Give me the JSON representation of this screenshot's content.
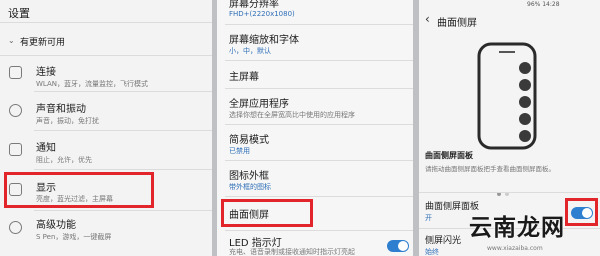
{
  "panel1": {
    "title": "设置",
    "update_label": "有更新可用",
    "items": [
      {
        "title": "连接",
        "sub": "WLAN，蓝牙，流量监控，飞行模式"
      },
      {
        "title": "声音和振动",
        "sub": "声音，振动，免打扰"
      },
      {
        "title": "通知",
        "sub": "阻止，允许，优先"
      },
      {
        "title": "显示",
        "sub": "亮度，蓝光过滤，主屏幕"
      },
      {
        "title": "高级功能",
        "sub": "S Pen，游戏，一键截屏"
      }
    ]
  },
  "panel2": {
    "items": [
      {
        "title": "屏幕分辨率",
        "sub": "FHD+(2220x1080)"
      },
      {
        "title": "屏幕缩放和字体",
        "sub": "小，中，默认"
      },
      {
        "title": "主屏幕",
        "sub": ""
      },
      {
        "title": "全屏应用程序",
        "sub": "选择你想在全屏宽高比中使用的应用程序"
      },
      {
        "title": "简易模式",
        "sub": "已禁用"
      },
      {
        "title": "图标外框",
        "sub": "带外框的图标"
      },
      {
        "title": "曲面侧屏",
        "sub": ""
      },
      {
        "title": "LED 指示灯",
        "sub": "充电、语音录制或接收通知时指示灯亮起"
      }
    ]
  },
  "panel3": {
    "status_text": "96% 14:28",
    "title": "曲面侧屏",
    "section_title": "曲面侧屏面板",
    "section_desc": "请拖动曲面侧屏面板把手查看曲面侧屏面板。",
    "panel_item": {
      "title": "曲面侧屏面板",
      "sub": "开"
    },
    "light_item": {
      "title": "侧屏闪光",
      "sub": "始终"
    }
  },
  "watermark": {
    "main": "云南龙网",
    "sub": "www.xiazaiba.com"
  },
  "colors": {
    "accent": "#2f7fd0",
    "highlight": "#e2252b"
  }
}
